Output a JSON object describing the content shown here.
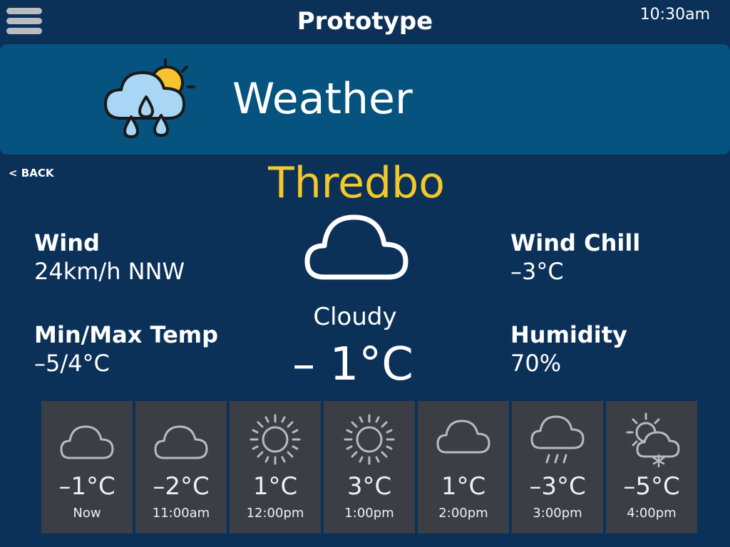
{
  "header": {
    "title": "Prototype",
    "time": "10:30am"
  },
  "banner": {
    "title": "Weather",
    "icon": "rain-sun-cloud-icon"
  },
  "nav": {
    "back_label": "< BACK"
  },
  "location": {
    "city": "Thredbo"
  },
  "current": {
    "icon": "cloud-icon",
    "condition": "Cloudy",
    "temperature": "– 1°C"
  },
  "stats": {
    "wind": {
      "label": "Wind",
      "value": "24km/h NNW"
    },
    "min_max": {
      "label": "Min/Max Temp",
      "value": " –5/4°C"
    },
    "wind_chill": {
      "label": "Wind Chill",
      "value": " –3°C"
    },
    "humidity": {
      "label": "Humidity",
      "value": " 70%"
    }
  },
  "hourly": [
    {
      "icon": "cloud-icon",
      "temp": "–1°C",
      "time": "Now"
    },
    {
      "icon": "cloud-icon",
      "temp": "–2°C",
      "time": "11:00am"
    },
    {
      "icon": "sun-icon",
      "temp": "1°C",
      "time": "12:00pm"
    },
    {
      "icon": "sun-icon",
      "temp": "3°C",
      "time": "1:00pm"
    },
    {
      "icon": "cloud-icon",
      "temp": "1°C",
      "time": "2:00pm"
    },
    {
      "icon": "rain-cloud-icon",
      "temp": "–3°C",
      "time": "3:00pm"
    },
    {
      "icon": "snow-sun-cloud-icon",
      "temp": "–5°C",
      "time": "4:00pm"
    }
  ],
  "colors": {
    "background": "#0c3158",
    "banner": "#06537f",
    "city": "#f2c928",
    "card": "#3b3e44",
    "sun": "#f6c431",
    "rain_cloud": "#a9d6f5"
  }
}
